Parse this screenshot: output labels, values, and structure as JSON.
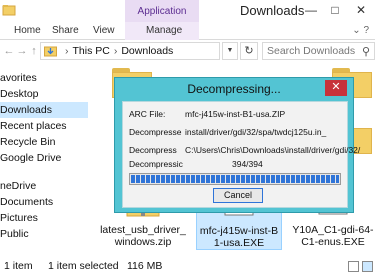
{
  "window": {
    "title": "Downloads",
    "context_tab": "Application Tools",
    "min_glyph": "—",
    "max_glyph": "□",
    "close_glyph": "✕"
  },
  "ribbon": {
    "tabs": [
      "Home",
      "Share",
      "View",
      "Manage"
    ]
  },
  "address": {
    "crumbs": [
      "This PC",
      "Downloads"
    ],
    "search_placeholder": "Search Downloads"
  },
  "sidebar": {
    "items": [
      "avorites",
      "Desktop",
      "Downloads",
      "Recent places",
      "Recycle Bin",
      "Google Drive",
      "neDrive",
      "Documents",
      "Pictures",
      "Public"
    ],
    "selected_index": 2
  },
  "files": [
    {
      "label_line1": "latest_usb_driver_",
      "label_line2": "windows.zip"
    },
    {
      "label_line1": "mfc-j415w-inst-B",
      "label_line2": "1-usa.EXE"
    },
    {
      "label_line1": "Y10A_C1-gdi-64-",
      "label_line2": "C1-enus.EXE"
    }
  ],
  "status": {
    "items_count": "1 item",
    "selected": "1 item selected",
    "size": "116 MB"
  },
  "dialog": {
    "title": "Decompressing...",
    "close_glyph": "✕",
    "arc_label": "ARC File:",
    "arc_value": "mfc-j415w-inst-B1-usa.ZIP",
    "decompress_label": "Decompresse",
    "decompress_value": "install/driver/gdi/32/spa/twdcj125u.in_",
    "decompress2_label": "Decompress",
    "decompress2_value": "C:\\Users\\Chris\\Downloads\\install/driver/gdi/32/",
    "count_label": "Decompressic",
    "count_value": "394/394",
    "progress_fraction": 1.0,
    "cancel_label": "Cancel"
  },
  "colors": {
    "dialog_frame": "#53c4d3",
    "progress": "#2f74d8",
    "close": "#c7323a",
    "selection": "#cce8ff",
    "context_tab": "#e9dcf3"
  }
}
